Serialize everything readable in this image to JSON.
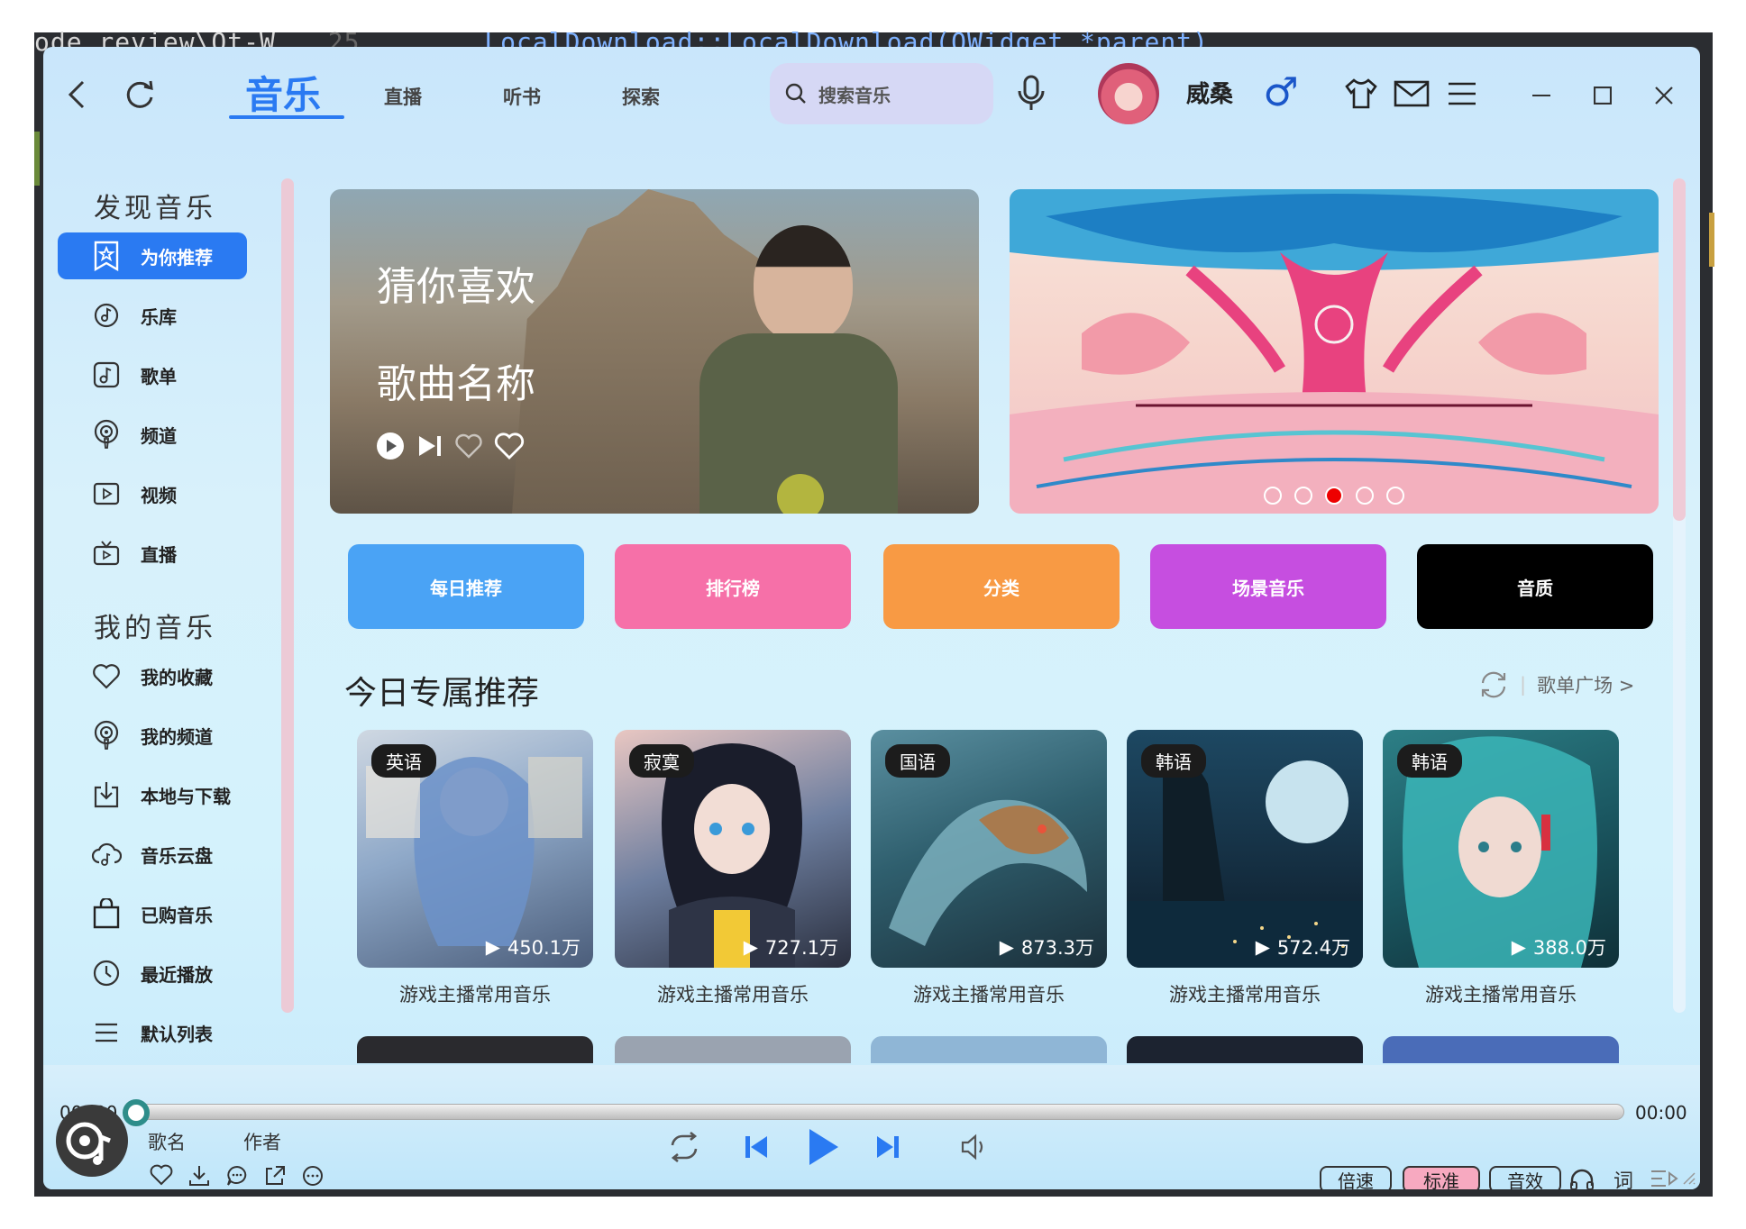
{
  "background_code": {
    "line_start": "ode_review\\Qt-W",
    "line_num": "25",
    "line_code": "LocalDownload::LocalDownload(QWidget *parent)"
  },
  "topnav": {
    "tabs": [
      "音乐",
      "直播",
      "听书",
      "探索"
    ],
    "active_tab": "音乐",
    "search_placeholder": "搜索音乐",
    "username": "威桑",
    "gender_symbol": "♂"
  },
  "sidebar": {
    "discover_heading": "发现音乐",
    "discover_items": [
      "为你推荐",
      "乐库",
      "歌单",
      "频道",
      "视频",
      "直播"
    ],
    "mymusic_heading": "我的音乐",
    "mymusic_items": [
      "我的收藏",
      "我的频道",
      "本地与下载",
      "音乐云盘",
      "已购音乐",
      "最近播放",
      "默认列表"
    ],
    "active_item": "为你推荐"
  },
  "banner": {
    "line1": "猜你喜欢",
    "line2": "歌曲名称",
    "slide_count": 5,
    "active_slide": 3
  },
  "categories": [
    {
      "label": "每日推荐",
      "color": "#4aa3f5"
    },
    {
      "label": "排行榜",
      "color": "#f670a8"
    },
    {
      "label": "分类",
      "color": "#f89a44"
    },
    {
      "label": "场景音乐",
      "color": "#c64ee0"
    },
    {
      "label": "音质",
      "color": "#000000"
    }
  ],
  "section": {
    "title": "今日专属推荐",
    "link": "歌单广场 >"
  },
  "playlists": [
    {
      "tag": "英语",
      "count": "450.1万",
      "title": "游戏主播常用音乐"
    },
    {
      "tag": "寂寞",
      "count": "727.1万",
      "title": "游戏主播常用音乐"
    },
    {
      "tag": "国语",
      "count": "873.3万",
      "title": "游戏主播常用音乐"
    },
    {
      "tag": "韩语",
      "count": "572.4万",
      "title": "游戏主播常用音乐"
    },
    {
      "tag": "韩语",
      "count": "388.0万",
      "title": "游戏主播常用音乐"
    }
  ],
  "player": {
    "time_current": "00::00",
    "time_total": "00:00",
    "progress": 0,
    "song_name": "歌名",
    "artist": "作者",
    "speed_label": "倍速",
    "quality_label": "标准",
    "effect_label": "音效",
    "lyrics_label": "词"
  },
  "colors": {
    "accent": "#2a7af2",
    "quality_bg": "#f7a9c0",
    "progress_knob": "#2e8d8a"
  }
}
